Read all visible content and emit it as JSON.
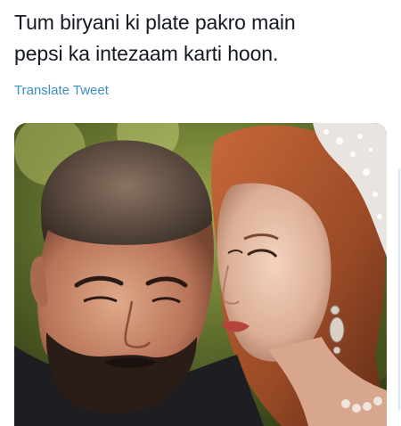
{
  "tweet": {
    "text": "Tum biryani ki plate pakro main\npepsi ka intezaam karti hoon.",
    "translate_label": "Translate Tweet",
    "link_color": "#3a8fc4",
    "text_color": "#141823"
  },
  "media": {
    "icon": "photo-icon"
  }
}
